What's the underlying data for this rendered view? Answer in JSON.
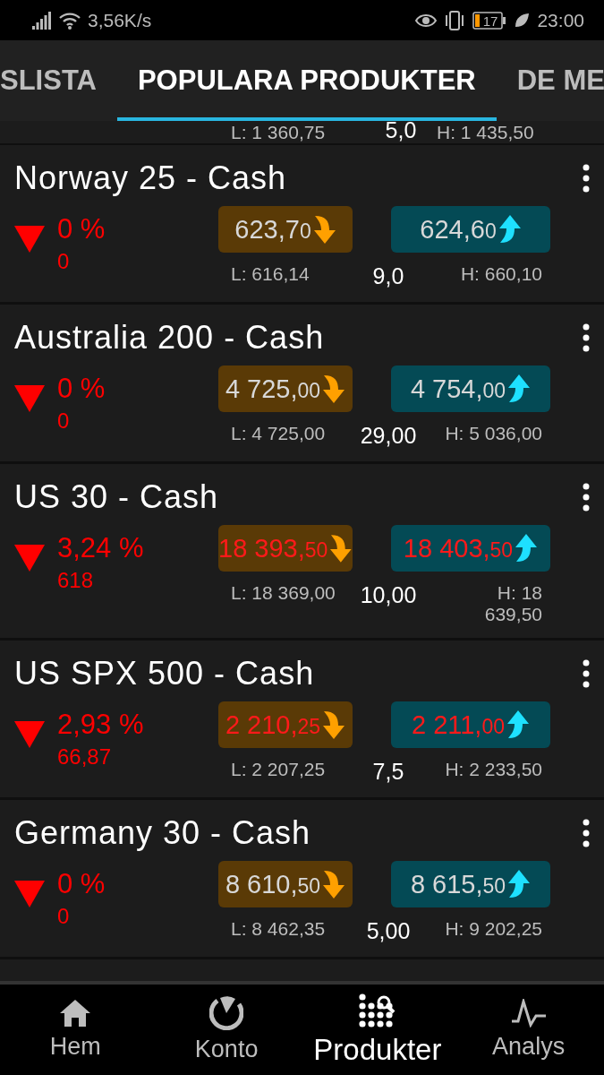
{
  "status_bar": {
    "speed": "3,56K/s",
    "battery": "17",
    "time": "23:00"
  },
  "tabs": [
    {
      "label": "SLISTA",
      "selected": false
    },
    {
      "label": "POPULARA PRODUKTER",
      "selected": true
    },
    {
      "label": "DE ME",
      "selected": false
    }
  ],
  "partial_row": {
    "low": "L: 1 360,75",
    "spread": "5,0",
    "high": "H: 1 435,50"
  },
  "instruments": [
    {
      "name": "Norway 25 - Cash",
      "falling": true,
      "change_pct": "0 %",
      "change": "0",
      "changed": false,
      "bid": {
        "main": "623,7",
        "small": "0"
      },
      "ask": {
        "main": "624,6",
        "small": "0"
      },
      "low": "L: 616,14",
      "spread": "9,0",
      "high": "H: 660,10"
    },
    {
      "name": "Australia 200 - Cash",
      "falling": true,
      "change_pct": "0 %",
      "change": "0",
      "changed": false,
      "bid": {
        "main": "4 725,",
        "small": "00"
      },
      "ask": {
        "main": "4 754,",
        "small": "00"
      },
      "low": "L: 4 725,00",
      "spread": "29,00",
      "high": "H: 5 036,00"
    },
    {
      "name": "US 30 - Cash",
      "falling": true,
      "change_pct": "3,24 %",
      "change": "618",
      "changed": true,
      "bid": {
        "main": "18 393,",
        "small": "50"
      },
      "ask": {
        "main": "18 403,",
        "small": "50"
      },
      "low": "L: 18 369,00",
      "spread": "10,00",
      "high": "H: 18 639,50"
    },
    {
      "name": "US SPX 500 - Cash",
      "falling": true,
      "change_pct": "2,93 %",
      "change": "66,87",
      "changed": true,
      "bid": {
        "main": "2 210,",
        "small": "25"
      },
      "ask": {
        "main": "2 211,",
        "small": "00"
      },
      "low": "L: 2 207,25",
      "spread": "7,5",
      "high": "H: 2 233,50"
    },
    {
      "name": "Germany 30 - Cash",
      "falling": true,
      "change_pct": "0 %",
      "change": "0",
      "changed": false,
      "bid": {
        "main": "8 610,",
        "small": "50"
      },
      "ask": {
        "main": "8 615,",
        "small": "50"
      },
      "low": "L: 8 462,35",
      "spread": "5,00",
      "high": "H: 9 202,25"
    }
  ],
  "bottom_nav": [
    {
      "label": "Hem",
      "kind": "home",
      "selected": false
    },
    {
      "label": "Konto",
      "kind": "account",
      "selected": false
    },
    {
      "label": "Produkter",
      "kind": "products",
      "selected": true
    },
    {
      "label": "Analys",
      "kind": "analysis",
      "selected": false
    }
  ]
}
